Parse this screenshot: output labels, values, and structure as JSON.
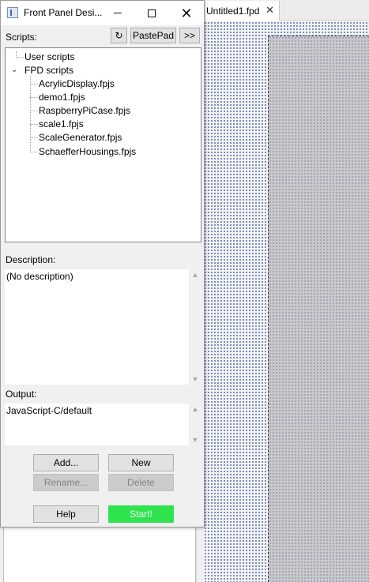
{
  "document": {
    "tab_label": "Untitled1.fpd",
    "tab_close_glyph": "✕"
  },
  "dialog": {
    "title": "Front Panel Desi...",
    "controls": {
      "minimize_icon": "minimize-icon",
      "maximize_icon": "maximize-icon",
      "close_glyph": "✕"
    },
    "scripts_label": "Scripts:",
    "toolbar": {
      "refresh_glyph": "↻",
      "pastepad_label": "PastePad",
      "expand_label": ">>"
    },
    "tree": {
      "expander_glyph": "⌄",
      "nodes": [
        {
          "label": "User scripts"
        },
        {
          "label": "FPD scripts"
        }
      ],
      "fpd_scripts": [
        "AcrylicDisplay.fpjs",
        "demo1.fpjs",
        "RaspberryPiCase.fpjs",
        "scale1.fpjs",
        "ScaleGenerator.fpjs",
        "SchaefferHousings.fpjs"
      ]
    },
    "description_label": "Description:",
    "description_text": "(No description)",
    "output_label": "Output:",
    "output_text": "JavaScript-C/default",
    "buttons": {
      "add": "Add...",
      "new": "New",
      "rename": "Rename...",
      "delete": "Delete",
      "help": "Help",
      "start": "Start!"
    }
  },
  "colors": {
    "start_button": "#2fe34f",
    "canvas_dots": "#5a6fb0",
    "panel_fill": "#c9c9cc"
  }
}
